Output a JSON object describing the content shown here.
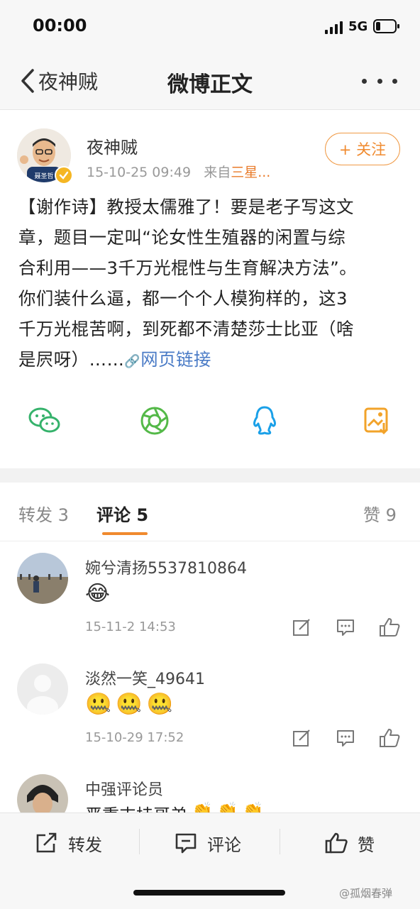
{
  "status_bar": {
    "time": "00:00",
    "network": "5G"
  },
  "nav": {
    "back_label": "夜神贼",
    "title": "微博正文"
  },
  "post": {
    "author": "夜神贼",
    "timestamp": "15-10-25 09:49",
    "source_prefix": "来自",
    "source": "三星...",
    "follow_label": "+ 关注",
    "avatar_caption": "聂圣哲",
    "text_lines": [
      "【谢作诗】教授太儒雅了！要是老子写这文",
      "章，题目一定叫“论女性生殖器的闲置与综",
      "合利用——3千万光棍性与生育解决方法”。",
      "你们装什么逼，都一个个人模狗样的，这3",
      "千万光棍苦啊，到死都不清楚莎士比亚（啥"
    ],
    "last_line": "是屄呀）……",
    "link_icon": "🔗",
    "link_label": "网页链接"
  },
  "share": {
    "icons": [
      "wechat-icon",
      "moments-icon",
      "qq-icon",
      "save-image-icon"
    ]
  },
  "tabs": {
    "repost": "转发 3",
    "comment": "评论 5",
    "like": "赞 9"
  },
  "comments": [
    {
      "name": "婉兮清扬5537810864",
      "emoji": [
        "😂"
      ],
      "time": "15-11-2 14:53"
    },
    {
      "name": "淡然一笑_49641",
      "emoji": [
        "🤐",
        "🤐",
        "🤐"
      ],
      "time": "15-10-29 17:52"
    },
    {
      "name": "中强评论员",
      "emoji": [
        "严重支持哥弟",
        "👏",
        "👏",
        "👏"
      ],
      "time": ""
    }
  ],
  "toolbar": {
    "repost": "转发",
    "comment": "评论",
    "like": "赞"
  },
  "watermark": "@孤烟春弹",
  "colors": {
    "accent": "#f08a2e",
    "link": "#4a7bc6",
    "verified": "#f5b623"
  }
}
